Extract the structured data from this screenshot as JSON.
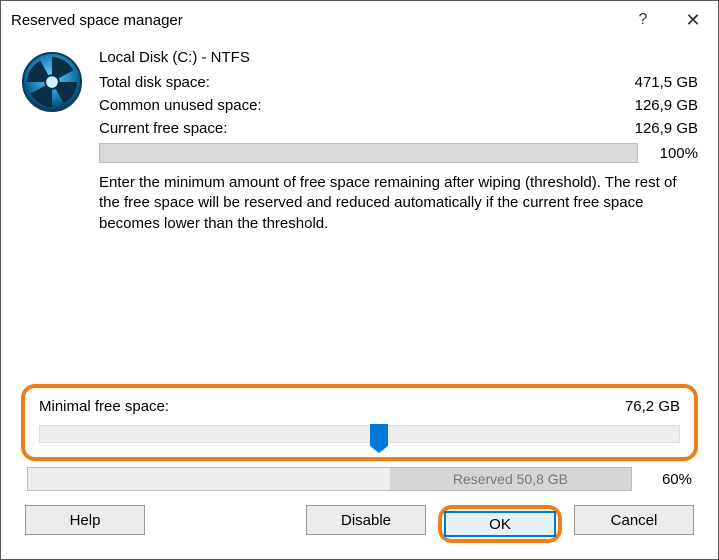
{
  "window": {
    "title": "Reserved space manager"
  },
  "disk": {
    "name": "Local Disk (C:) - NTFS",
    "total_label": "Total disk space:",
    "total_value": "471,5 GB",
    "common_label": "Common unused space:",
    "common_value": "126,9 GB",
    "free_label": "Current free space:",
    "free_value": "126,9 GB",
    "free_pct": "100%"
  },
  "description": "Enter the minimum amount of free space remaining after wiping (threshold). The rest of the free space will be reserved and reduced automatically if the current free space becomes lower than the threshold.",
  "minimal": {
    "label": "Minimal free space:",
    "value": "76,2 GB",
    "slider_position_pct": 53
  },
  "reserved": {
    "label": "Reserved 50,8 GB",
    "pct_text": "60%",
    "fill_width_pct": 40
  },
  "buttons": {
    "help": "Help",
    "disable": "Disable",
    "ok": "OK",
    "cancel": "Cancel"
  },
  "colors": {
    "highlight": "#ed7d1a",
    "primary": "#0078d7"
  }
}
